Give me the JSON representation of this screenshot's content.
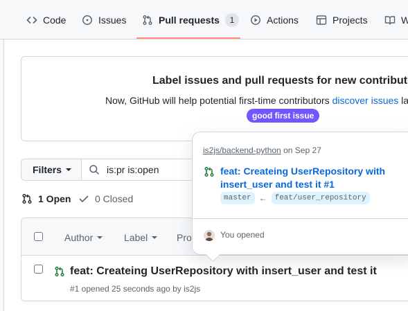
{
  "nav": {
    "code": "Code",
    "issues": "Issues",
    "pull_requests": "Pull requests",
    "pull_requests_count": "1",
    "actions": "Actions",
    "projects": "Projects",
    "wiki_partial": "W"
  },
  "banner": {
    "title": "Label issues and pull requests for new contributors",
    "text_prefix": "Now, GitHub will help potential first-time contributors",
    "text_link": "discover issues",
    "text_suffix": "la",
    "label": "good first issue",
    "label_color": "#7057ff"
  },
  "filters": {
    "button_label": "Filters",
    "search_value": "is:pr is:open"
  },
  "states": {
    "open": "1 Open",
    "closed": "0 Closed"
  },
  "list": {
    "header": {
      "author": "Author",
      "label": "Label",
      "projects_partial": "Pro"
    },
    "rows": [
      {
        "title": "feat: Createing UserRepository with insert_user and test it",
        "meta": "#1 opened 25 seconds ago by is2js"
      }
    ]
  },
  "hovercard": {
    "repo": "is2js/backend-python",
    "date": "on Sep 27",
    "title": "feat: Createing UserRepository with insert_user and test it #1",
    "base_branch": "master",
    "arrow": "←",
    "head_branch": "feat/user_repository",
    "opened_text": "You opened"
  },
  "colors": {
    "accent_underline": "#fd8c73",
    "link": "#0969da",
    "open_green": "#1a7f37"
  }
}
